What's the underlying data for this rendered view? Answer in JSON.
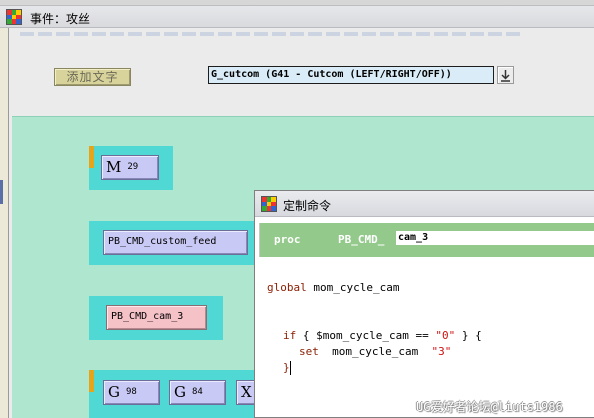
{
  "window": {
    "title": "事件：攻丝",
    "add_text_button": "添加文字",
    "command_select": {
      "value": "G_cutcom (G41 - Cutcom (LEFT/RIGHT/OFF))"
    }
  },
  "canvas": {
    "blocks": [
      {
        "big": "M",
        "small": "29"
      },
      {
        "label": "PB_CMD_custom_feed"
      },
      {
        "label": "PB_CMD_cam_3"
      },
      {
        "chips": [
          {
            "big": "G",
            "small": "98"
          },
          {
            "big": "G",
            "small": "84"
          },
          {
            "big": "X",
            "small": ""
          }
        ]
      }
    ]
  },
  "dialog": {
    "title": "定制命令",
    "proc_keyword": "proc",
    "proc_prefix": "PB_CMD_",
    "proc_name": "cam_3",
    "code_lines": [
      {
        "kw": "global",
        "text": " mom_cycle_cam"
      },
      {
        "kw": "if",
        "text": " { $mom_cycle_cam == ",
        "str": "\"0\"",
        "tail": " } {"
      },
      {
        "kw": "set",
        "text": "  mom_cycle_cam  ",
        "str": "\"3\""
      },
      {
        "text": "}"
      }
    ]
  },
  "watermark": "UG爱好者论坛@liuts1986",
  "colors": {
    "canvas": "#aee6cf",
    "block_bg": "#50d8d4",
    "chip_bg": "#c9c9f5",
    "chip_selected_bg": "#f5c2c8",
    "proc_bar": "#93c98a",
    "keyword": "#8a1d00",
    "string": "#d01010"
  }
}
